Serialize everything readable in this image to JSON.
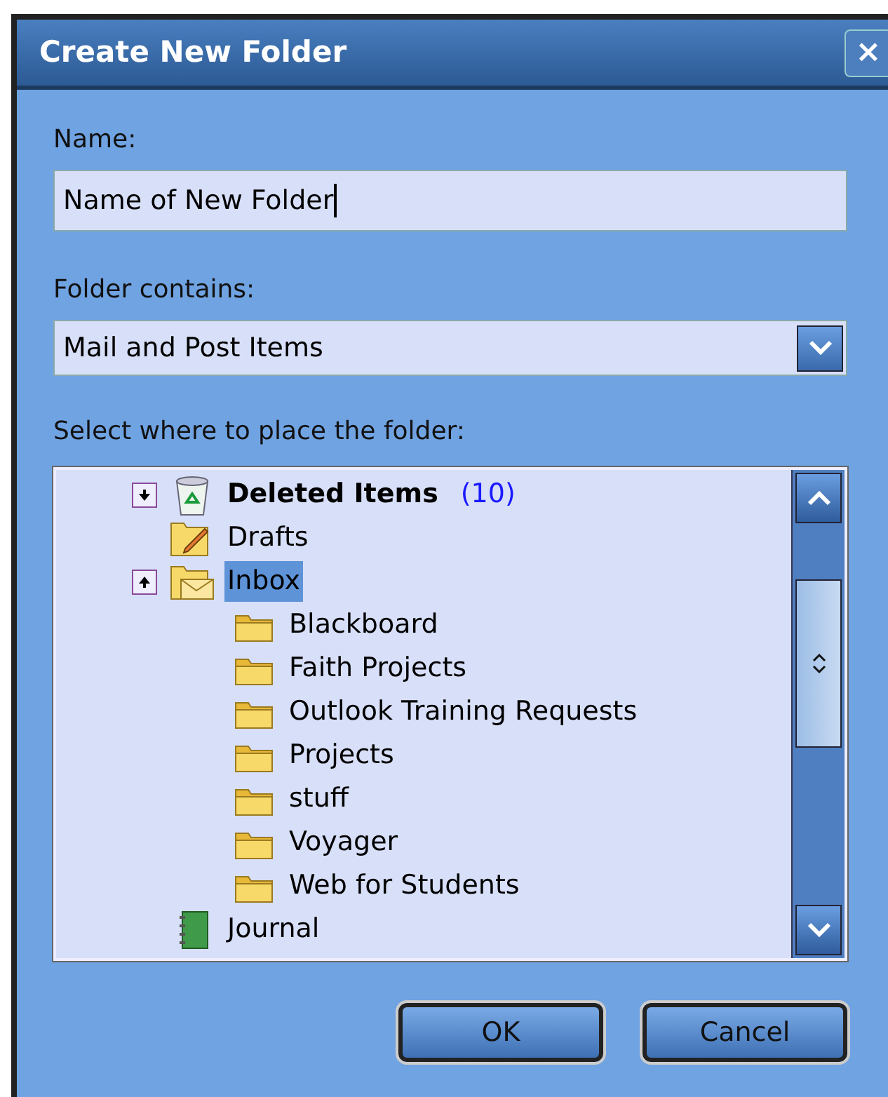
{
  "window": {
    "title": "Create New Folder",
    "close": "×"
  },
  "name_field": {
    "label": "Name:",
    "value": "Name of New Folder"
  },
  "contains": {
    "label": "Folder contains:",
    "value": "Mail and Post Items"
  },
  "tree": {
    "label": "Select where to place the folder:",
    "items": [
      {
        "kind": "trash",
        "label": "Deleted Items",
        "count": "(10)",
        "expanded": false,
        "selected": false
      },
      {
        "kind": "drafts",
        "label": "Drafts",
        "selected": false
      },
      {
        "kind": "inbox",
        "label": "Inbox",
        "expanded": true,
        "selected": true,
        "children": [
          {
            "kind": "folder",
            "label": "Blackboard",
            "selected": false
          },
          {
            "kind": "folder",
            "label": "Faith Projects",
            "selected": false
          },
          {
            "kind": "folder",
            "label": "Outlook Training Requests",
            "selected": false
          },
          {
            "kind": "folder",
            "label": "Projects",
            "selected": false
          },
          {
            "kind": "folder",
            "label": "stuff",
            "selected": false
          },
          {
            "kind": "folder",
            "label": "Voyager",
            "selected": false
          },
          {
            "kind": "folder",
            "label": "Web for Students",
            "selected": false
          }
        ]
      },
      {
        "kind": "journal",
        "label": "Journal",
        "selected": false
      }
    ]
  },
  "buttons": [
    "OK",
    "Cancel"
  ]
}
